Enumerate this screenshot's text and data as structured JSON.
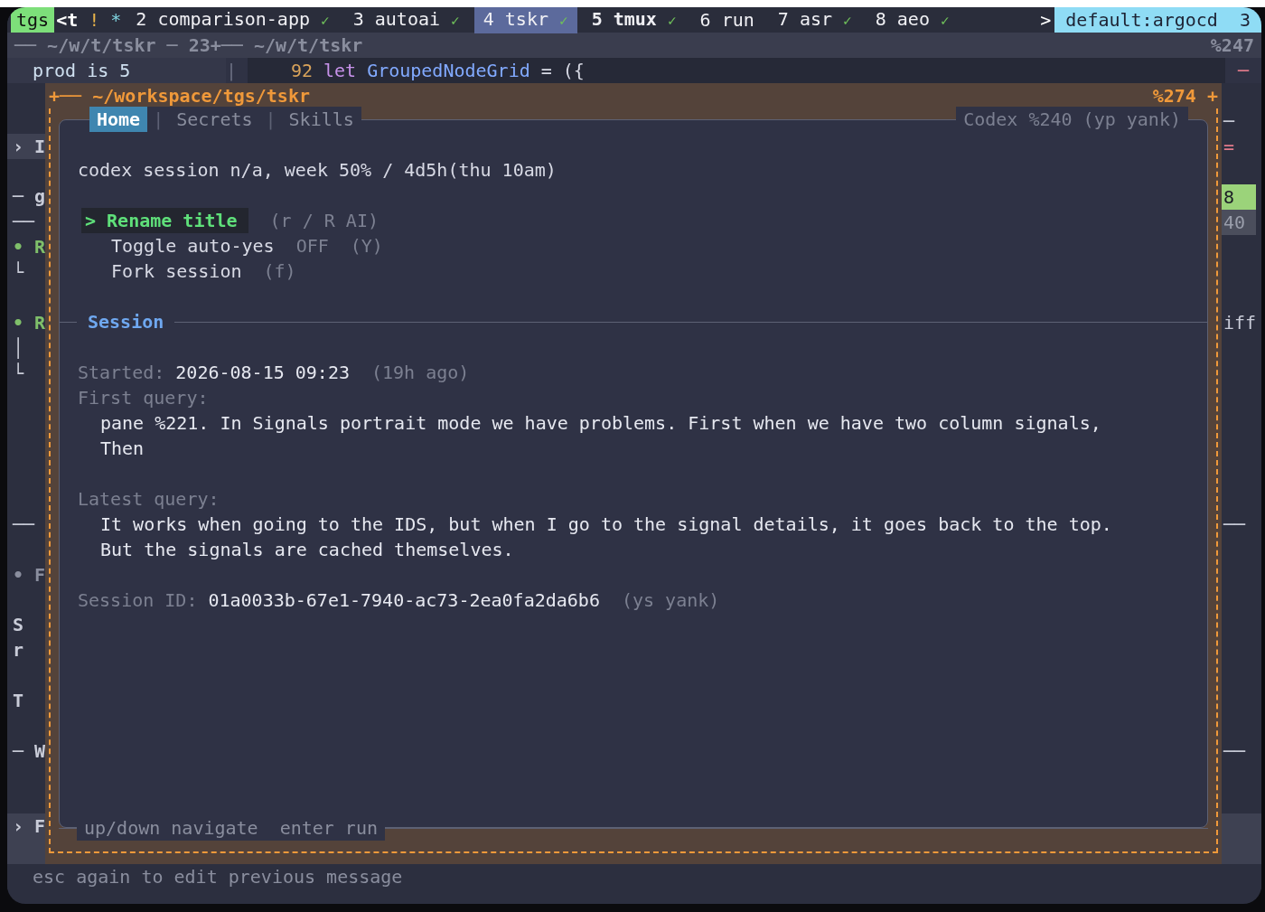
{
  "status_bar": {
    "session": "tgs",
    "prefix": "<t",
    "flags": [
      {
        "text": "!",
        "color": "#e8b34a"
      },
      {
        "text": "*",
        "color": "#7fd4e0"
      }
    ],
    "windows": [
      {
        "index": "2",
        "name": "comparison-app",
        "check": "✓",
        "selected": false,
        "bold": false
      },
      {
        "index": "3",
        "name": "autoai",
        "check": "✓",
        "selected": false,
        "bold": false
      },
      {
        "index": "4",
        "name": "tskr",
        "check": "✓",
        "selected": true,
        "bold": false
      },
      {
        "index": "5",
        "name": "tmux",
        "check": "✓",
        "selected": false,
        "bold": true
      },
      {
        "index": "6",
        "name": "run",
        "selected": false,
        "bold": false
      },
      {
        "index": "7",
        "name": "asr",
        "check": "✓",
        "selected": false,
        "bold": false
      },
      {
        "index": "8",
        "name": "aeo",
        "check": "✓",
        "selected": false,
        "bold": false
      }
    ],
    "overflow": ">",
    "right": "default:argocd  3"
  },
  "pane_header": {
    "left": "── ~/w/t/tskr ─ 23+── ~/w/t/tskr",
    "right": "%247"
  },
  "pane_line": {
    "left": "prod is 5",
    "separator": "|",
    "line_number": "92",
    "keyword": "let",
    "identifier": "GroupedNodeGrid",
    "rest": "= ({",
    "right_mark": "─"
  },
  "left_strip": [
    {
      "kind": "blank"
    },
    {
      "kind": "blank"
    },
    {
      "kind": "highlight",
      "text": "› I"
    },
    {
      "kind": "blank"
    },
    {
      "kind": "text",
      "text": "─ g"
    },
    {
      "kind": "text",
      "text": "──"
    },
    {
      "kind": "text",
      "text": "• R",
      "color": "#7fbf6a"
    },
    {
      "kind": "text",
      "text": "└"
    },
    {
      "kind": "blank"
    },
    {
      "kind": "text",
      "text": "• R",
      "color": "#7fbf6a"
    },
    {
      "kind": "text",
      "text": "│"
    },
    {
      "kind": "text",
      "text": "└"
    },
    {
      "kind": "blank"
    },
    {
      "kind": "blank"
    },
    {
      "kind": "blank"
    },
    {
      "kind": "blank"
    },
    {
      "kind": "blank"
    },
    {
      "kind": "text",
      "text": "──"
    },
    {
      "kind": "blank"
    },
    {
      "kind": "text",
      "text": "• F",
      "color": "#8a8e9e"
    },
    {
      "kind": "blank"
    },
    {
      "kind": "text",
      "text": "S"
    },
    {
      "kind": "text",
      "text": "r"
    },
    {
      "kind": "blank"
    },
    {
      "kind": "text",
      "text": "T"
    },
    {
      "kind": "blank"
    },
    {
      "kind": "text",
      "text": "─ W"
    },
    {
      "kind": "blank"
    },
    {
      "kind": "blank"
    },
    {
      "kind": "highlight",
      "text": "› F"
    },
    {
      "kind": "highlight_blank"
    }
  ],
  "right_strip": [
    {
      "kind": "blank"
    },
    {
      "kind": "text",
      "text": "─"
    },
    {
      "kind": "accent",
      "text": "="
    },
    {
      "kind": "blank"
    },
    {
      "kind": "badge_on",
      "text": "8"
    },
    {
      "kind": "badge_off",
      "text": "40"
    },
    {
      "kind": "blank"
    },
    {
      "kind": "blank"
    },
    {
      "kind": "blank"
    },
    {
      "kind": "text",
      "text": "iff"
    },
    {
      "kind": "blank"
    },
    {
      "kind": "blank"
    },
    {
      "kind": "blank"
    },
    {
      "kind": "blank"
    },
    {
      "kind": "blank"
    },
    {
      "kind": "blank"
    },
    {
      "kind": "blank"
    },
    {
      "kind": "text",
      "text": "──"
    },
    {
      "kind": "blank"
    },
    {
      "kind": "blank"
    },
    {
      "kind": "blank"
    },
    {
      "kind": "blank"
    },
    {
      "kind": "blank"
    },
    {
      "kind": "blank"
    },
    {
      "kind": "blank"
    },
    {
      "kind": "blank"
    },
    {
      "kind": "text",
      "text": "──"
    },
    {
      "kind": "blank"
    },
    {
      "kind": "blank"
    },
    {
      "kind": "highlight_blank"
    },
    {
      "kind": "highlight_blank"
    }
  ],
  "popup": {
    "title_prefix": "+──",
    "title": "~/workspace/tgs/tskr",
    "pane_id": "%274",
    "corner": "+",
    "tabs": [
      {
        "label": "Home",
        "selected": true
      },
      {
        "label": "Secrets",
        "selected": false
      },
      {
        "label": "Skills",
        "selected": false
      }
    ],
    "tab_separators": [
      "|",
      "|"
    ],
    "header_right": "Codex %240 (yp yank)",
    "usage": "codex session n/a, week 50% / 4d5h(thu 10am)",
    "actions": [
      {
        "label": "Rename title",
        "hint": "(r / R AI)",
        "selected": true,
        "cursor": ">"
      },
      {
        "label": "Toggle auto-yes",
        "value": "OFF",
        "hint": "(Y)",
        "selected": false
      },
      {
        "label": "Fork session",
        "hint": "(f)",
        "selected": false
      }
    ],
    "section": "Session",
    "started": {
      "label": "Started:",
      "value": "2026-08-15 09:23",
      "note": "(19h ago)"
    },
    "first_query": {
      "label": "First query:",
      "lines": [
        "pane %221. In Signals portrait mode we have problems. First when we have two column signals,",
        "Then"
      ]
    },
    "latest_query": {
      "label": "Latest query:",
      "lines": [
        "It works when going to the IDS, but when I go to the signal details, it goes back to the top.",
        "But the signals are cached themselves."
      ]
    },
    "session_id": {
      "label": "Session ID:",
      "value": "01a0033b-67e1-7940-ac73-2ea0fa2da6b6",
      "note": "(ys yank)"
    },
    "footer": [
      {
        "key": "up/down",
        "action": "navigate"
      },
      {
        "key": "enter",
        "action": "run"
      }
    ]
  },
  "prompt": "esc again to edit previous message"
}
